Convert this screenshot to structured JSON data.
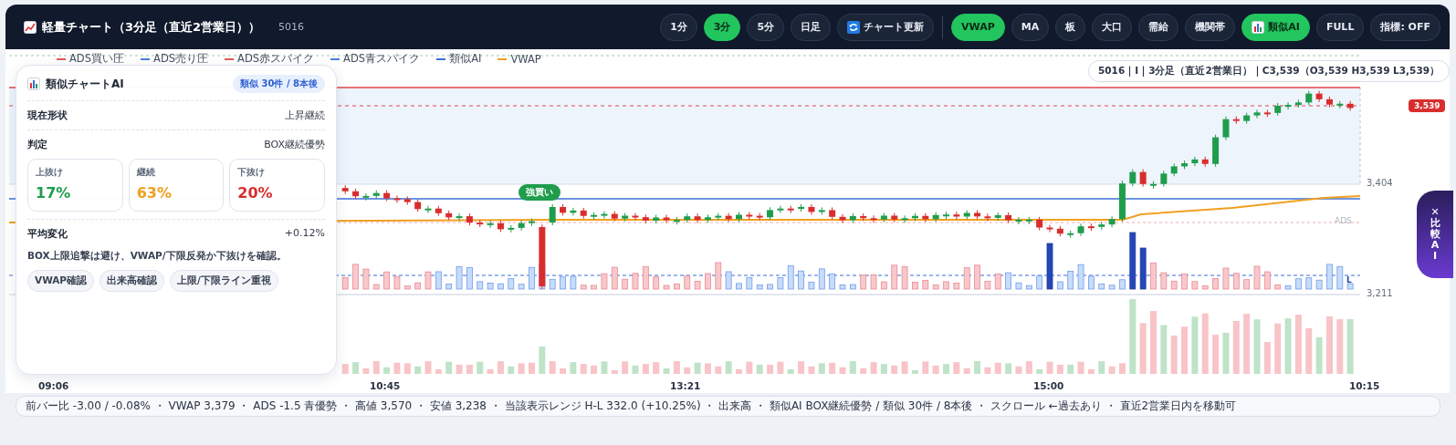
{
  "header": {
    "title": "軽量チャート（3分足（直近2営業日））",
    "code": "5016",
    "timeframes": [
      {
        "label": "1分",
        "selected": false
      },
      {
        "label": "3分",
        "selected": true
      },
      {
        "label": "5分",
        "selected": false
      },
      {
        "label": "日足",
        "selected": false
      }
    ],
    "refresh_button": {
      "label": "チャート更新"
    },
    "toggles": [
      {
        "label": "VWAP",
        "on": true,
        "kind": "plain"
      },
      {
        "label": "MA",
        "on": false,
        "kind": "plain"
      },
      {
        "label": "板",
        "on": false,
        "kind": "plain"
      },
      {
        "label": "大口",
        "on": false,
        "kind": "plain"
      },
      {
        "label": "需給",
        "on": false,
        "kind": "plain"
      },
      {
        "label": "機関帯",
        "on": false,
        "kind": "plain"
      },
      {
        "label": "類似AI",
        "on": true,
        "kind": "icon"
      },
      {
        "label": "FULL",
        "on": false,
        "kind": "plain"
      },
      {
        "label": "指標: OFF",
        "on": false,
        "kind": "plain"
      }
    ]
  },
  "chart": {
    "legend": [
      {
        "label": "ADS買い圧",
        "color": "#e05a5a"
      },
      {
        "label": "ADS売り圧",
        "color": "#4a7fe0"
      },
      {
        "label": "ADS赤スパイク",
        "color": "#e05a5a"
      },
      {
        "label": "ADS青スパイク",
        "color": "#4a7fe0"
      },
      {
        "label": "類似AI",
        "color": "#3b6fd8"
      },
      {
        "label": "VWAP",
        "color": "#f0a020"
      }
    ],
    "info": "5016｜I｜3分足（直近2営業日）｜C3,539（O3,539 H3,539 L3,539）",
    "price_badge": "3,539",
    "signal": "強買い",
    "ads_label": "ADS",
    "marker": "L",
    "y_labels": [
      "3,404",
      "3,211"
    ],
    "x_labels": [
      "09:06",
      "10:45",
      "13:21",
      "15:00",
      "10:15"
    ]
  },
  "ai_panel": {
    "title": "類似チャートAI",
    "badge": "類似 30件 / 8本後",
    "rows": [
      {
        "label": "現在形状",
        "value": "上昇継続"
      },
      {
        "label": "判定",
        "value": "BOX継続優勢"
      }
    ],
    "stats": [
      {
        "label": "上抜け",
        "value": "17%",
        "color": "#1f9d4c"
      },
      {
        "label": "継続",
        "value": "63%",
        "color": "#f0a020"
      },
      {
        "label": "下抜け",
        "value": "20%",
        "color": "#d92d2d"
      }
    ],
    "average": {
      "label": "平均変化",
      "value": "+0.12%"
    },
    "note": "BOX上限追撃は避け、VWAP/下限反発か下抜けを確認。",
    "chips": [
      "VWAP確認",
      "出来高確認",
      "上限/下限ライン重視"
    ]
  },
  "compare_button": {
    "icon": "✕",
    "label": "比較AI"
  },
  "status_bar": "前バー比 -3.00 / -0.08% ・ VWAP 3,379 ・ ADS -1.5 青優勢 ・ 高値 3,570 ・ 安値 3,238 ・ 当該表示レンジ H-L 332.0 (+10.25%) ・ 出来高 ・ 類似AI BOX継続優勢 / 類似 30件 / 8本後 ・ スクロール ←過去あり ・ 直近2営業日内を移動可"
}
